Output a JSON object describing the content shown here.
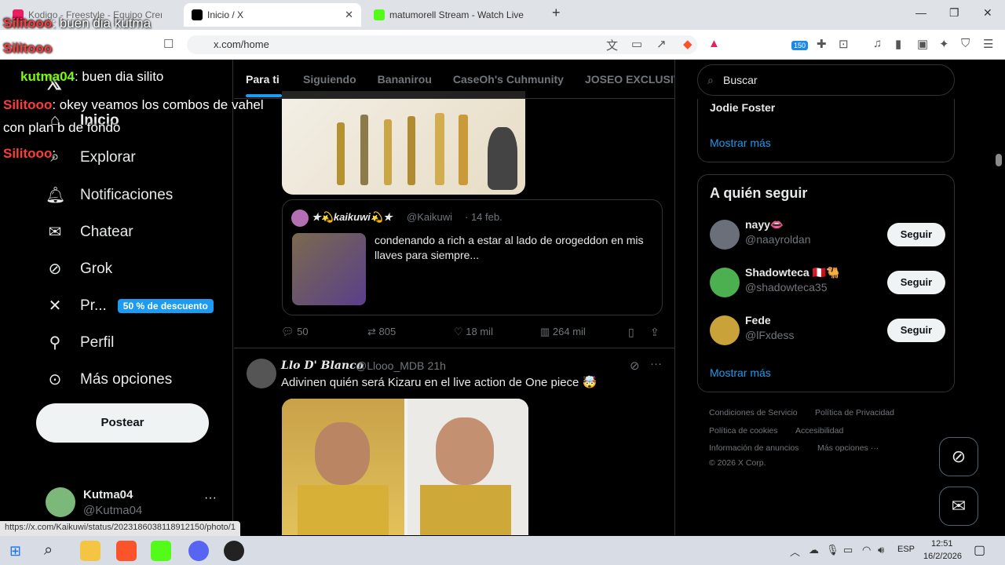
{
  "browser": {
    "tabs": [
      {
        "label": "Kodigo - Freestyle - Equipo Crem"
      },
      {
        "label": "Inicio / X"
      },
      {
        "label": "matumorell Stream - Watch Live"
      }
    ],
    "url": "x.com/home",
    "status_url": "https://x.com/Kaikuwi/status/2023186038118912150/photo/1",
    "brave_badge": "150"
  },
  "nav": {
    "items": [
      {
        "label": "Inicio",
        "icon": "home-icon"
      },
      {
        "label": "Explorar",
        "icon": "search-icon"
      },
      {
        "label": "Notificaciones",
        "icon": "bell-icon"
      },
      {
        "label": "Chatear",
        "icon": "mail-icon"
      },
      {
        "label": "Grok",
        "icon": "grok-icon"
      },
      {
        "label": "Pr...",
        "icon": "x-icon"
      },
      {
        "label": "Perfil",
        "icon": "user-icon"
      },
      {
        "label": "Más opciones",
        "icon": "more-icon"
      }
    ],
    "premium_promo": "50 % de descuento",
    "post_button": "Postear",
    "account": {
      "name": "Kutma04",
      "handle": "@Kutma04"
    }
  },
  "feed": {
    "tabs": [
      "Para ti",
      "Siguiendo",
      "Bananirou",
      "CaseOh's Cuhmunity",
      "JOSEO EXCLUSIV"
    ],
    "quote": {
      "name": "★💫kaikuwi💫★",
      "handle": "@Kaikuwi",
      "date": "· 14 feb.",
      "text": "condenando a rich a estar al lado de orogeddon en mis llaves para siempre..."
    },
    "actions1": {
      "replies": "50",
      "reposts": "805",
      "likes": "18 mil",
      "views": "264 mil"
    },
    "post2": {
      "name": "Llo D' Blanco",
      "handle": "@Llooo_MDB",
      "time": "· 21h",
      "text": "Adivinen quién será Kizaru en el live action de One piece 🤯"
    }
  },
  "right": {
    "search_placeholder": "Buscar",
    "trend_name": "Jodie Foster",
    "show_more_1": "Mostrar más",
    "who_to_follow_title": "A quién seguir",
    "follows": [
      {
        "name": "nayy👄",
        "handle": "@naayroldan",
        "button": "Seguir"
      },
      {
        "name": "Shadowteca 🇵🇪🐫",
        "handle": "@shadowteca35",
        "button": "Seguir"
      },
      {
        "name": "Fede",
        "handle": "@lFxdess",
        "button": "Seguir"
      }
    ],
    "show_more_2": "Mostrar más",
    "footer": [
      "Condiciones de Servicio",
      "Política de Privacidad",
      "Política de cookies",
      "Accesibilidad",
      "Información de anuncios",
      "Más opciones ···",
      "© 2026 X Corp."
    ]
  },
  "overlay_chat": [
    {
      "nick": "Silitooo",
      "text": ": buen dia kutma"
    },
    {
      "nick": "Silitooo",
      "text": ""
    },
    {
      "nick": "kutma04",
      "text": ": buen dia silito"
    },
    {
      "nick": "Silitooo",
      "text": ": okey veamos los combos de vahel"
    },
    {
      "nick": "",
      "text": "con plan b de fondo"
    },
    {
      "nick": "Silitooo",
      "text": ":"
    }
  ],
  "taskbar": {
    "lang": "ESP",
    "time": "12:51",
    "date": "16/2/2026"
  },
  "colors": {
    "accent": "#1d9bf0",
    "bg": "#000000",
    "border": "#2f3336",
    "muted": "#71767b"
  }
}
